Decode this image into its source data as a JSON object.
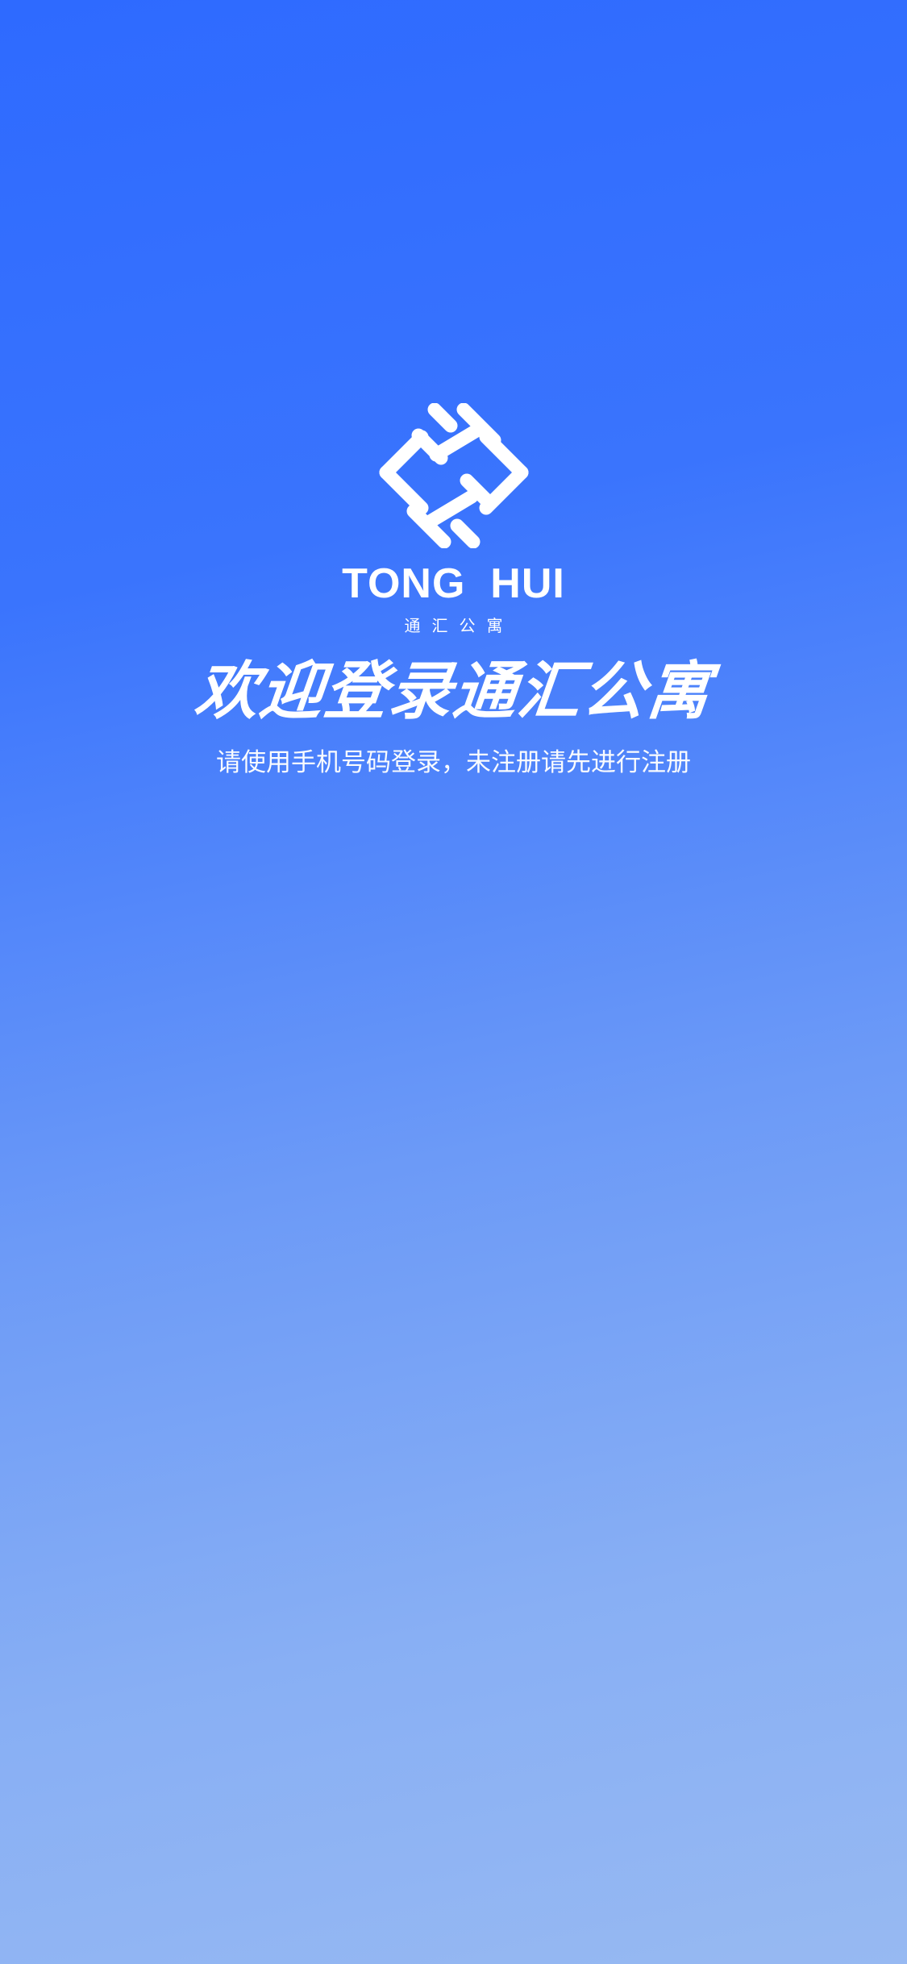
{
  "logo": {
    "icon": "tong-hui-lattice-logo-icon",
    "brand_en": "TONG  HUI",
    "brand_cn": "通汇公寓"
  },
  "welcome": {
    "title": "欢迎登录通汇公寓",
    "subtitle": "请使用手机号码登录，未注册请先进行注册"
  },
  "colors": {
    "gradient_top": "#2E6AFF",
    "gradient_bottom": "#97B9F2",
    "text": "#FFFFFF"
  }
}
